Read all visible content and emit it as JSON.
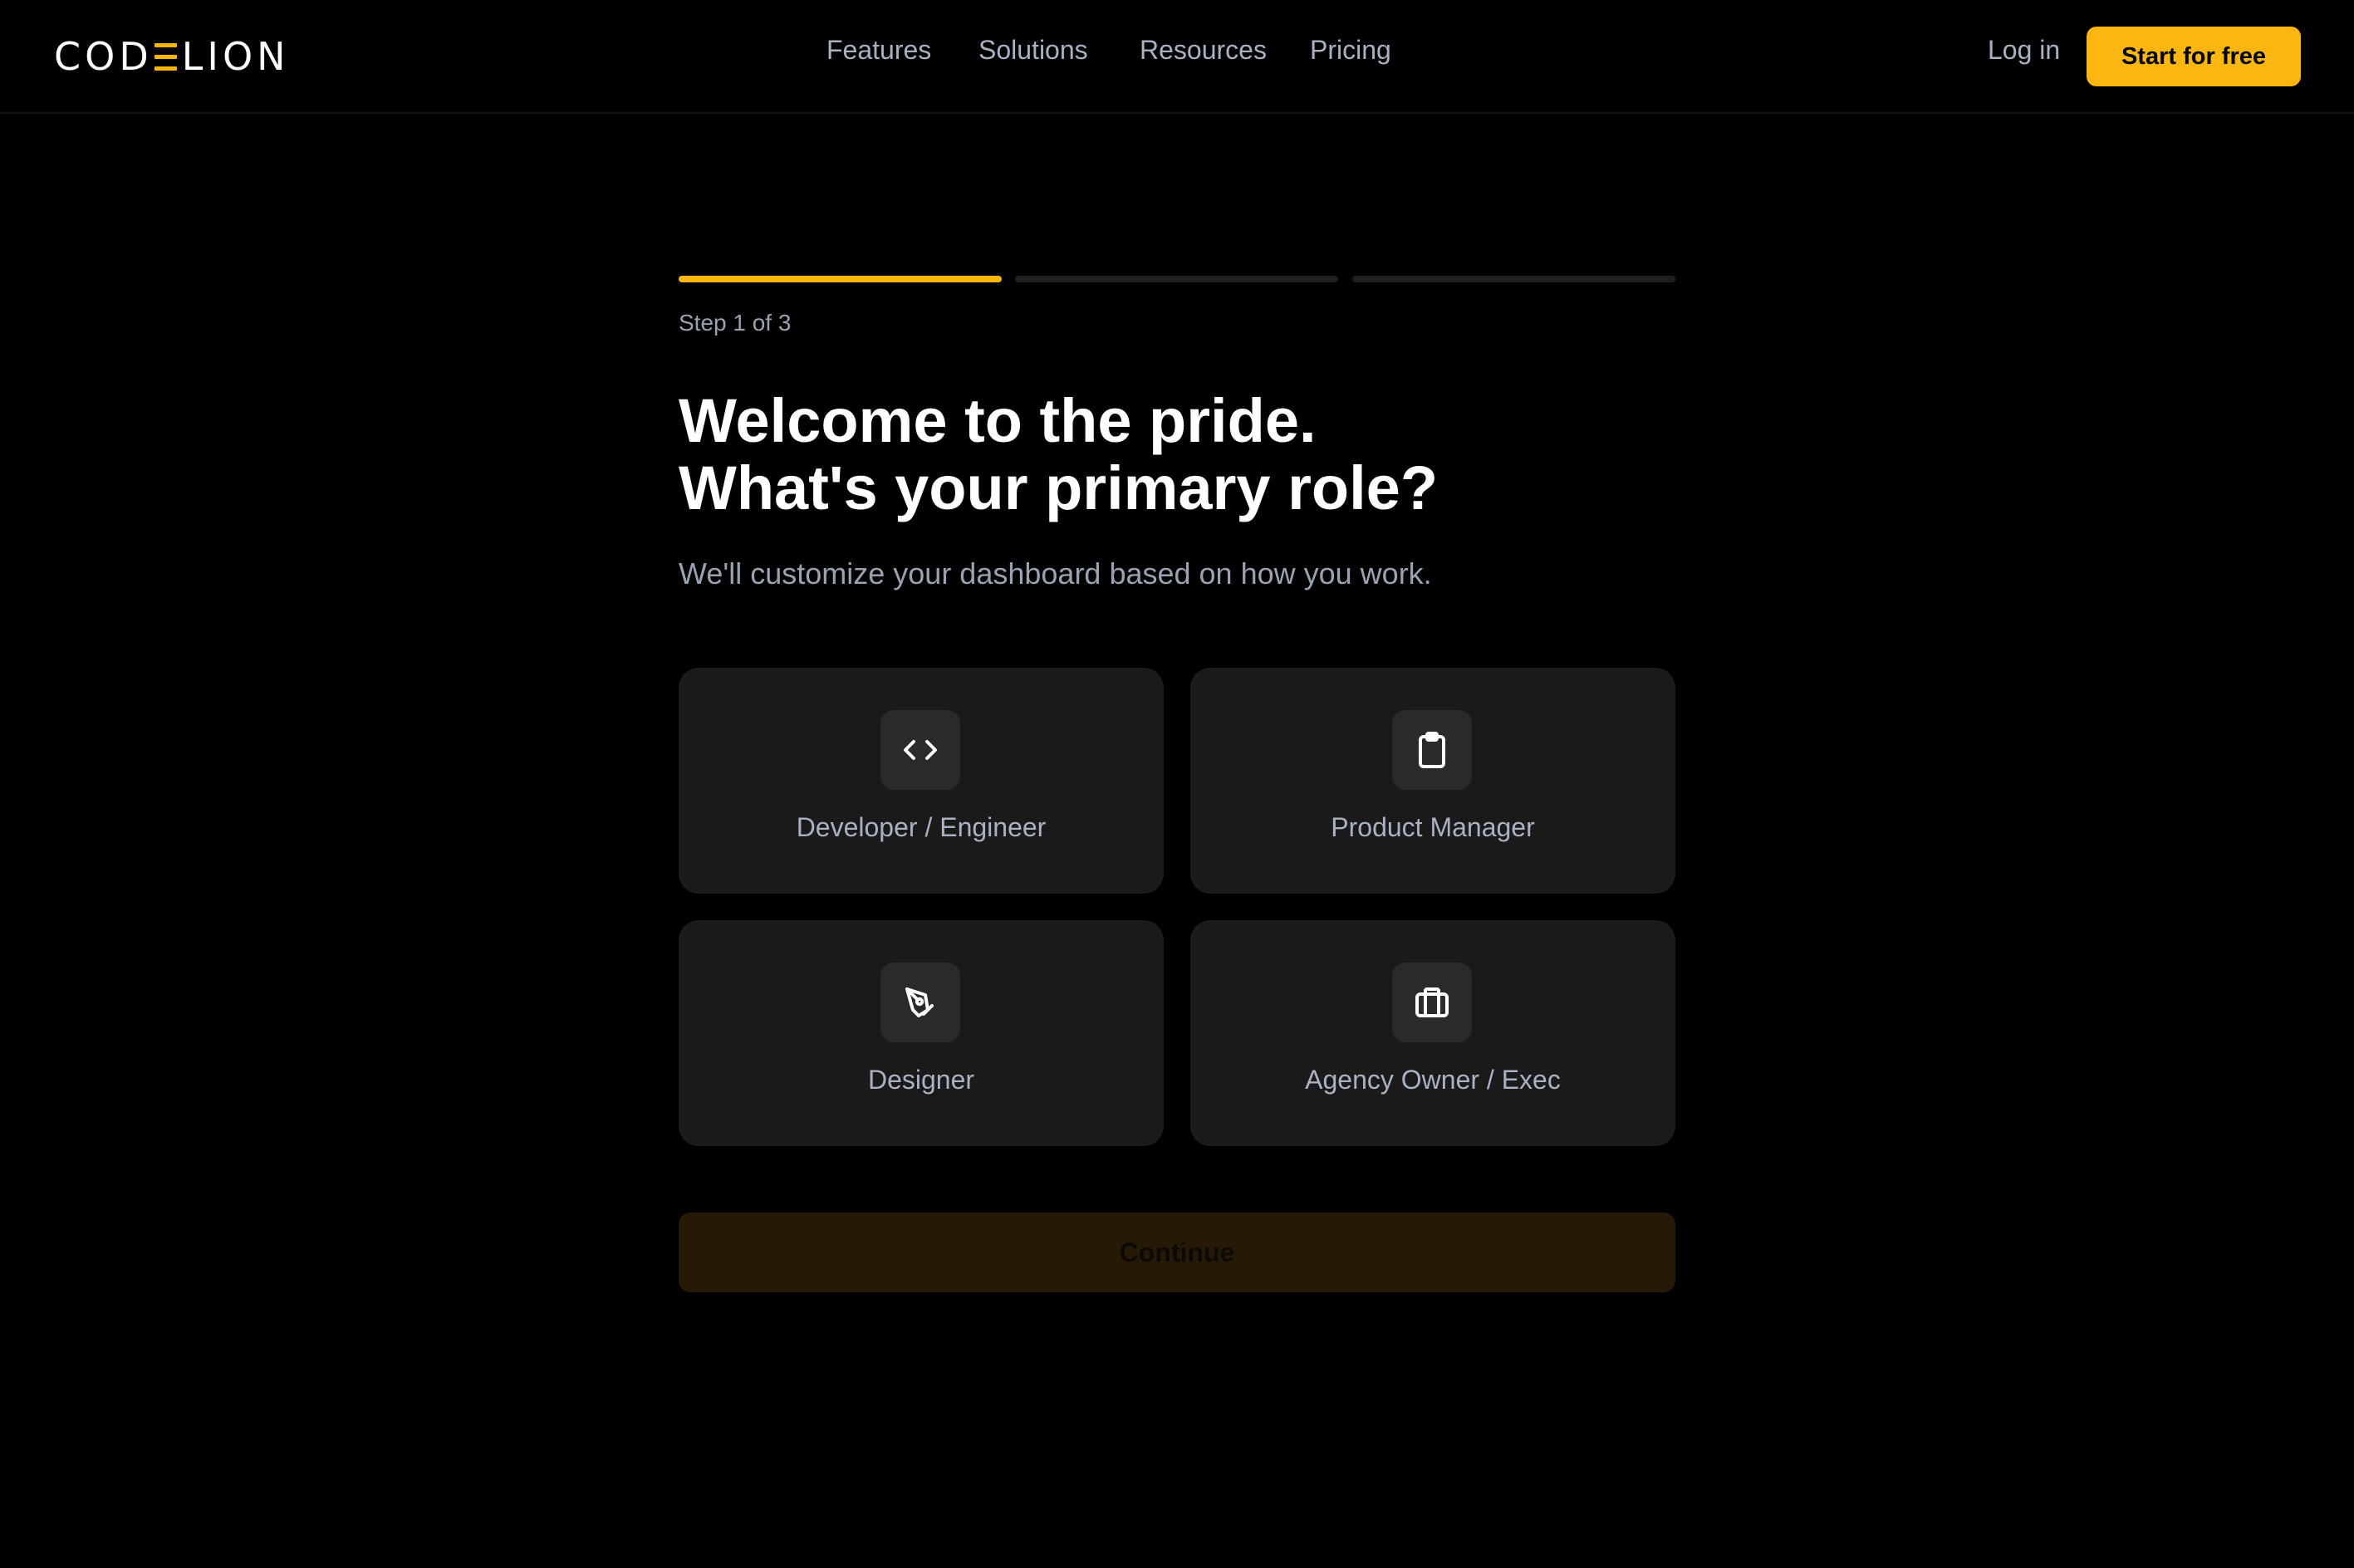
{
  "nav": {
    "logo": {
      "left": "COD",
      "right": "LION"
    },
    "links": [
      {
        "label": "Features"
      },
      {
        "label": "Solutions"
      },
      {
        "label": "Resources"
      },
      {
        "label": "Pricing"
      }
    ],
    "login_label": "Log in",
    "cta_label": "Start for free"
  },
  "onboarding": {
    "progress": {
      "current_step": 1,
      "total_steps": 3
    },
    "step_label": "Step 1 of 3",
    "title_line1": "Welcome to the pride.",
    "title_line2": "What's your primary role?",
    "subtitle": "We'll customize your dashboard based on how you work.",
    "roles": [
      {
        "label": "Developer / Engineer",
        "icon": "code-icon"
      },
      {
        "label": "Product Manager",
        "icon": "clipboard-icon"
      },
      {
        "label": "Designer",
        "icon": "pen-tool-icon"
      },
      {
        "label": "Agency Owner / Exec",
        "icon": "briefcase-icon"
      }
    ],
    "continue_label": "Continue"
  },
  "colors": {
    "background": "#000000",
    "accent": "#fbb70f",
    "card": "#1a1a1a",
    "icon_tile": "#2a2a2a",
    "muted_text": "#a9b1c2",
    "progress_inactive": "#1f1f1f",
    "continue_disabled": "#261a06"
  }
}
